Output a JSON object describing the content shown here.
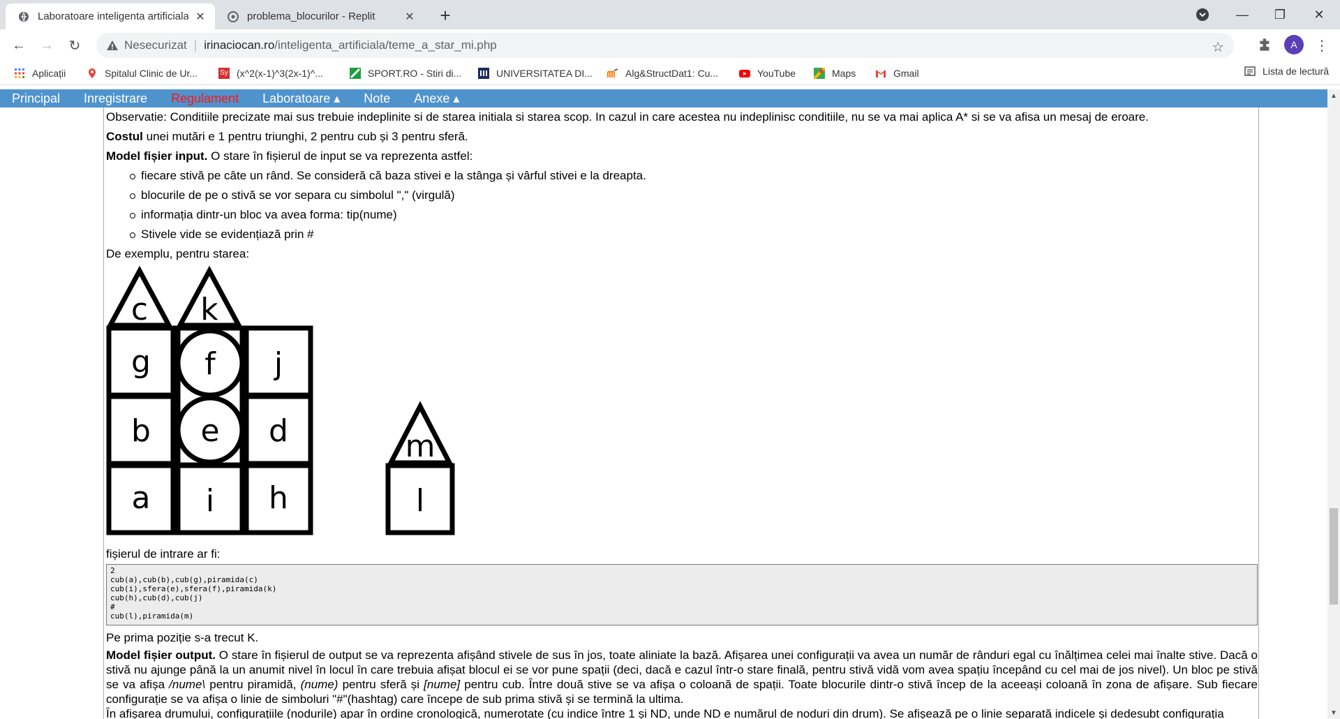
{
  "browser": {
    "tabs": [
      {
        "title": "Laboratoare inteligenta artificiala",
        "close": "✕",
        "active": true
      },
      {
        "title": "problema_blocurilor - Replit",
        "close": "✕",
        "active": false
      }
    ],
    "new_tab": "+",
    "window_controls": {
      "minimize": "—",
      "maximize": "❐",
      "close": "✕"
    },
    "insecure_label": "Nesecurizat",
    "url_host": "irinaciocan.ro",
    "url_path": "/inteligenta_artificiala/teme_a_star_mi.php",
    "avatar_letter": "A",
    "bookmarks": [
      {
        "label": "Aplicații",
        "icon": "apps-grid-icon"
      },
      {
        "label": "Spitalul Clinic de Ur...",
        "icon": "maps-pin-icon"
      },
      {
        "label": "(x^2(x-1)^3(2x-1)^...",
        "icon": "symbolab-icon"
      },
      {
        "label": "SPORT.RO - Stiri di...",
        "icon": "sport-ro-icon"
      },
      {
        "label": "UNIVERSITATEA DI...",
        "icon": "university-icon"
      },
      {
        "label": "Alg&StructDat1: Cu...",
        "icon": "moodle-icon"
      },
      {
        "label": "YouTube",
        "icon": "youtube-icon"
      },
      {
        "label": "Maps",
        "icon": "maps-icon"
      },
      {
        "label": "Gmail",
        "icon": "gmail-icon"
      }
    ],
    "reading_list": "Lista de lectură"
  },
  "site_nav": [
    {
      "label": "Principal",
      "highlight": false
    },
    {
      "label": "Inregistrare",
      "highlight": false
    },
    {
      "label": "Regulament",
      "highlight": true
    },
    {
      "label": "Laboratoare ▴",
      "highlight": false
    },
    {
      "label": "Note",
      "highlight": false
    },
    {
      "label": "Anexe ▴",
      "highlight": false
    }
  ],
  "content": {
    "observatie": "Observatie: Conditiile precizate mai sus trebuie indeplinite si de starea initiala si starea scop. In cazul in care acestea nu indeplinisc conditiile, nu se va mai aplica A* si se va afisa un mesaj de eroare.",
    "cost_bold": "Costul",
    "cost_text": " unei mutări e 1 pentru triunghi, 2 pentru cub și 3 pentru sferă.",
    "input_bold": "Model fișier input.",
    "input_text": " O stare în fișierul de input se va reprezenta astfel:",
    "bullets": [
      "fiecare stivă pe câte un rând. Se consideră că baza stivei e la stânga și vârful stivei e la dreapta.",
      "blocurile de pe o stivă se vor separa cu simbolul \",\" (virgulă)",
      "informația dintr-un bloc va avea forma: tip(nume)",
      "Stivele vide se evidențiază prin #"
    ],
    "example_intro": "De exemplu, pentru starea:",
    "file_intro": "fișierul de intrare ar fi:",
    "code_lines": [
      "2",
      "cub(a),cub(b),cub(g),piramida(c)",
      "cub(i),sfera(e),sfera(f),piramida(k)",
      "cub(h),cub(d),cub(j)",
      "#",
      "cub(l),piramida(m)"
    ],
    "first_position": "Pe prima poziție s-a trecut K.",
    "output_bold": "Model fișier output.",
    "output_text_1": " O stare în fișierul de output se va reprezenta afișând stivele de sus în jos, toate aliniate la bază. Afișarea unei configurații va avea un număr de rânduri egal cu înălțimea celei mai înalte stive. Dacă o stivă nu ajunge până la un anumit nivel în locul în care trebuia afișat blocul ei se vor pune spații (deci, dacă e cazul într-o stare finală, pentru stivă vidă vom avea spațiu începând cu cel mai de jos nivel). Un bloc pe stivă se va afișa ",
    "output_pyr": "/nume\\",
    "output_text_2": " pentru piramidă, ",
    "output_sph": "(nume)",
    "output_text_3": " pentru sferă și ",
    "output_cube": "[nume]",
    "output_text_4": " pentru cub. Între două stive se va afișa o coloană de spații. Toate blocurile dintr-o stivă încep de la aceeași coloană în zona de afișare. Sub fiecare configurație se va afișa o linie de simboluri \"#\"(hashtag) care începe de sub prima stivă și se termină la ultima.",
    "last_line": "În afișarea drumului, configurațiile (nodurile) apar în ordine cronologică, numerotate (cu indice între 1 și ND, unde ND e numărul de noduri din drum). Se afișează pe o linie separată indicele și dedesubt configurația",
    "blocks": {
      "stack1": [
        "a",
        "b",
        "g",
        "c"
      ],
      "stack2": [
        "i",
        "e",
        "f",
        "k"
      ],
      "stack3": [
        "h",
        "d",
        "j"
      ],
      "stack4": [
        "l",
        "m"
      ]
    }
  }
}
